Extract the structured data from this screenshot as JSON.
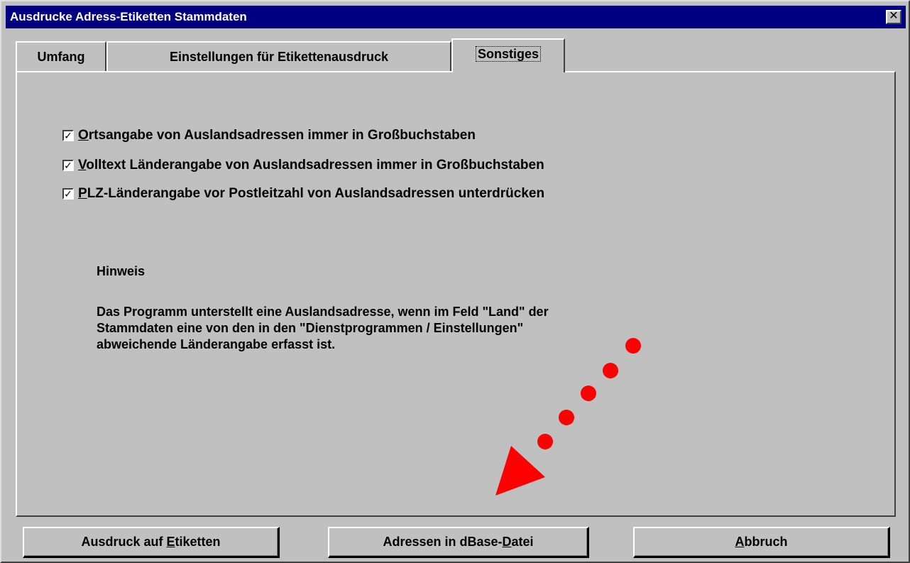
{
  "window": {
    "title": "Ausdrucke Adress-Etiketten Stammdaten",
    "close_glyph": "✕"
  },
  "tabs": [
    {
      "label": "Umfang",
      "active": false
    },
    {
      "label": "Einstellungen für Etikettenausdruck",
      "active": false
    },
    {
      "label": "Sonstiges",
      "active": true
    }
  ],
  "options": [
    {
      "underlined": "O",
      "rest": "rtsangabe von Auslandsadressen immer in Großbuchstaben",
      "checked": true
    },
    {
      "underlined": "V",
      "rest": "olltext Länderangabe von Auslandsadressen immer in Großbuchstaben",
      "checked": true
    },
    {
      "underlined": "P",
      "rest": "LZ-Länderangabe vor Postleitzahl von Auslandsadressen unterdrücken",
      "checked": true
    }
  ],
  "hint": {
    "title": "Hinweis",
    "lines": [
      "Das Programm unterstellt eine Auslandsadresse, wenn im Feld \"Land\" der",
      "Stammdaten eine von den in den \"Dienstprogrammen / Einstellungen\"",
      "abweichende Länderangabe erfasst ist."
    ]
  },
  "buttons": {
    "print_labels": {
      "before": "Ausdruck auf ",
      "underlined": "E",
      "after": "tiketten"
    },
    "dbase_export": {
      "before": "Adressen in dBase-",
      "underlined": "D",
      "after": "atei"
    },
    "cancel": {
      "before": "",
      "underlined": "A",
      "after": "bbruch"
    }
  },
  "annotation": {
    "color": "#ff0000"
  }
}
